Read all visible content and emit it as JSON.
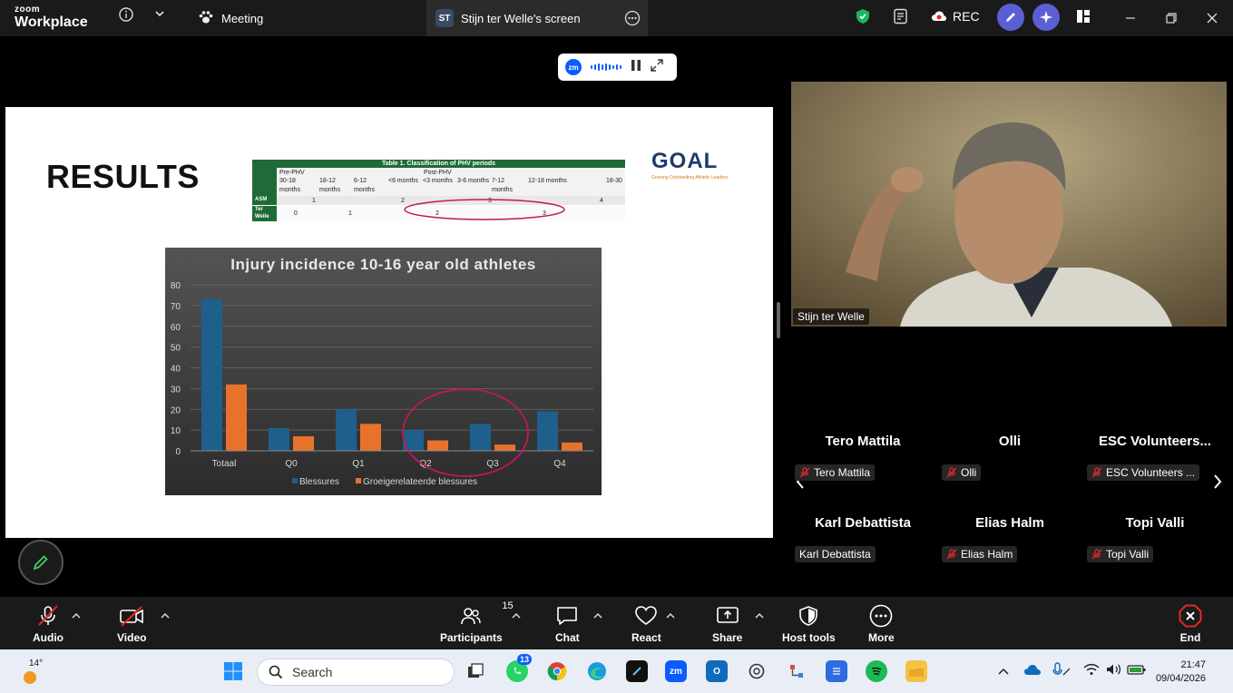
{
  "app": {
    "brand_top": "zoom",
    "brand_bottom": "Workplace",
    "meeting_tab": "Meeting",
    "screen_tab_badge": "ST",
    "screen_tab": "Stijn ter Welle's screen",
    "rec_label": "REC"
  },
  "share_control": {
    "logo": "zm"
  },
  "slide": {
    "heading": "RESULTS",
    "logo_text": "GOAL",
    "logo_sub": "Growing Outstanding Athletic Leaders",
    "table": {
      "caption": "Table 1. Classification of PHV periods",
      "pre": "Pre-PHV",
      "post": "Post-PHV",
      "periods": [
        "30-18 months",
        "18-12 months",
        "6-12 months",
        "<6 months",
        "<3 months",
        "3-6 months",
        "7-12 months",
        "12-18 months",
        "18-30"
      ],
      "asm_label": "ASM",
      "asm_values": [
        "1",
        "2",
        "3",
        "4"
      ],
      "tw_label": "Ter Welle",
      "tw_values": [
        "0",
        "1",
        "2",
        "3"
      ]
    }
  },
  "chart_data": {
    "type": "bar",
    "title": "Injury incidence 10-16 year old athletes",
    "categories": [
      "Totaal",
      "Q0",
      "Q1",
      "Q2",
      "Q3",
      "Q4"
    ],
    "series": [
      {
        "name": "Blessures",
        "values": [
          73,
          11,
          20,
          10,
          13,
          19
        ],
        "color": "#1f5f8b"
      },
      {
        "name": "Groeigerelateerde blessures",
        "values": [
          32,
          7,
          13,
          5,
          3,
          4
        ],
        "color": "#e8722c"
      }
    ],
    "ylim": [
      0,
      80
    ],
    "yticks": [
      "0",
      "10",
      "20",
      "30",
      "40",
      "50",
      "60",
      "70",
      "80"
    ],
    "grid": true,
    "legend": "bottom"
  },
  "video": {
    "name": "Stijn ter Welle"
  },
  "participants": [
    {
      "display": "Tero Mattila",
      "tag": "Tero Mattila",
      "muted": true
    },
    {
      "display": "Olli",
      "tag": "Olli",
      "muted": true
    },
    {
      "display": "ESC  Volunteers...",
      "tag": "ESC Volunteers ...",
      "muted": true
    },
    {
      "display": "Karl Debattista",
      "tag": "Karl Debattista",
      "muted": false
    },
    {
      "display": "Elias Halm",
      "tag": "Elias Halm",
      "muted": true
    },
    {
      "display": "Topi Valli",
      "tag": "Topi Valli",
      "muted": true
    }
  ],
  "toolbar": {
    "audio": "Audio",
    "video": "Video",
    "participants": "Participants",
    "participants_count": "15",
    "chat": "Chat",
    "react": "React",
    "share": "Share",
    "host_tools": "Host tools",
    "more": "More",
    "end": "End"
  },
  "taskbar": {
    "temperature": "14°",
    "search_placeholder": "Search",
    "whatsapp_badge": "13",
    "time": "21:47",
    "date": "09/04/2026"
  },
  "colors": {
    "zoom_blue": "#0b5cff",
    "end_red": "#e02828",
    "mute_red": "#e02828",
    "shield_green": "#1ab55c"
  }
}
